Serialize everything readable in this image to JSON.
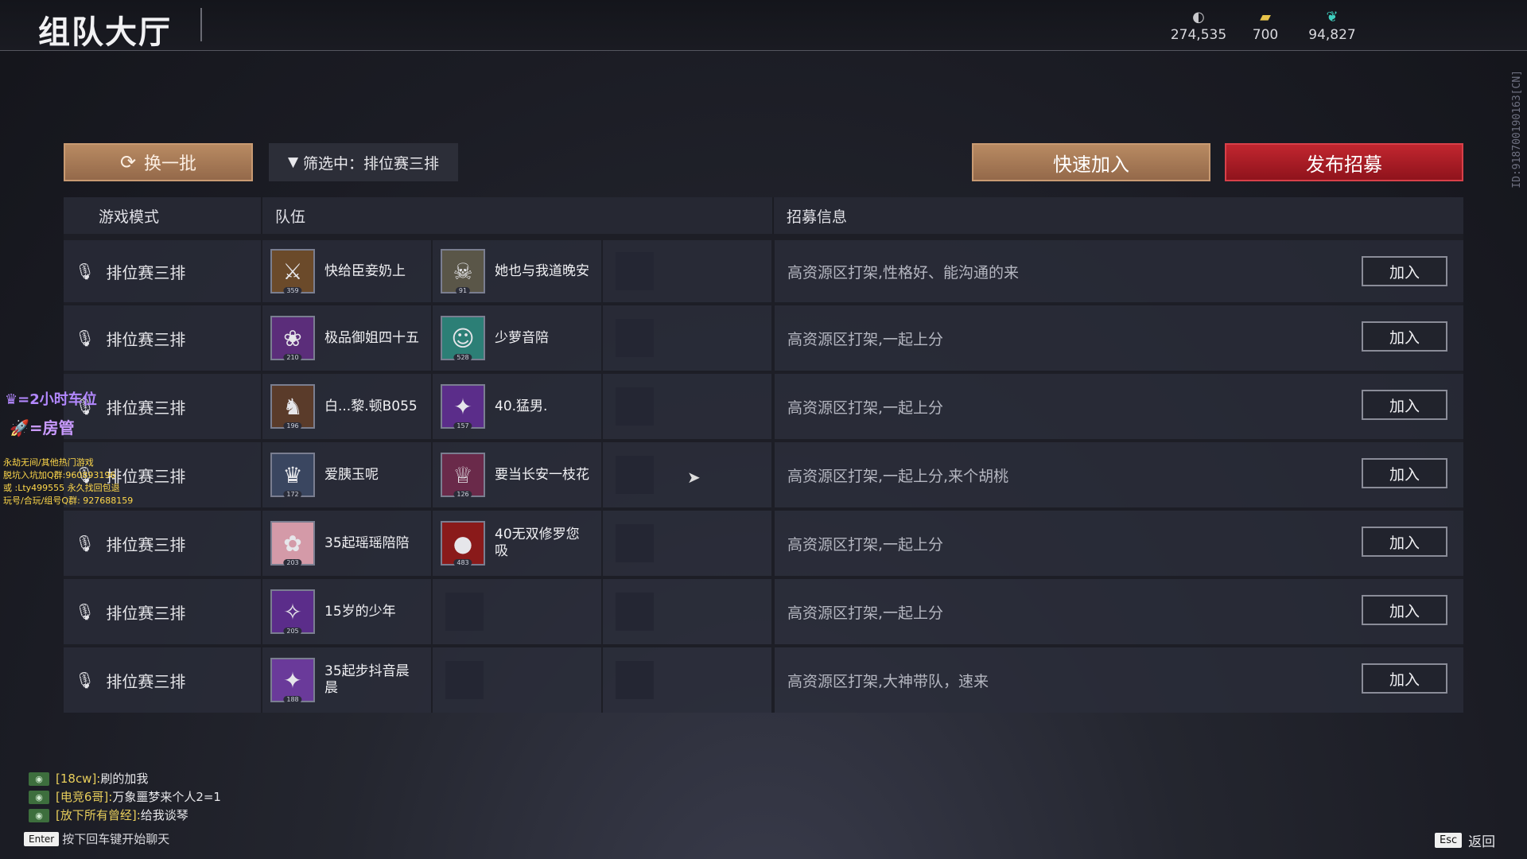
{
  "header": {
    "title": "组队大厅",
    "currencies": [
      {
        "icon": "silver-coin-icon",
        "glyph": "◐",
        "value": "274,535"
      },
      {
        "icon": "gold-ticket-icon",
        "glyph": "▰",
        "value": "700"
      },
      {
        "icon": "feather-icon",
        "glyph": "❦",
        "value": "94,827"
      }
    ],
    "side_id": "ID:9187001901​63[CN]"
  },
  "toolbar": {
    "refresh_label": "换一批",
    "filter_label": "筛选中：排位赛三排",
    "quick_join_label": "快速加入",
    "publish_label": "发布招募"
  },
  "table": {
    "headers": {
      "mode": "游戏模式",
      "team": "队伍",
      "info": "招募信息"
    },
    "join_label": "加入",
    "rows": [
      {
        "mode": "排位赛三排",
        "members": [
          {
            "name": "快给臣妾奶上",
            "level": "359",
            "glyph": "⚔",
            "bg": "#6b4a2a"
          },
          {
            "name": "她也与我道晚安",
            "level": "91",
            "glyph": "☠",
            "bg": "#5a5648"
          }
        ],
        "info": "高资源区打架,性格好、能沟通的来"
      },
      {
        "mode": "排位赛三排",
        "members": [
          {
            "name": "极品御姐四十五",
            "level": "210",
            "glyph": "❀",
            "bg": "#5b2d7a"
          },
          {
            "name": "少萝音陪",
            "level": "528",
            "glyph": "☺",
            "bg": "#2c7f76"
          }
        ],
        "info": "高资源区打架,一起上分"
      },
      {
        "mode": "排位赛三排",
        "members": [
          {
            "name": "白...黎.顿B055",
            "level": "196",
            "glyph": "♞",
            "bg": "#5a3b2a"
          },
          {
            "name": "40.猛男.",
            "level": "157",
            "glyph": "✦",
            "bg": "#5b2d8a"
          }
        ],
        "info": "高资源区打架,一起上分"
      },
      {
        "mode": "排位赛三排",
        "members": [
          {
            "name": "爱胰玉呢",
            "level": "172",
            "glyph": "♛",
            "bg": "#3a4660"
          },
          {
            "name": "要当长安一枝花",
            "level": "126",
            "glyph": "♕",
            "bg": "#6a2a4a"
          }
        ],
        "info": "高资源区打架,一起上分,来个胡桃"
      },
      {
        "mode": "排位赛三排",
        "members": [
          {
            "name": "35起瑶瑶陪陪",
            "level": "203",
            "glyph": "✿",
            "bg": "#d49aa8"
          },
          {
            "name": "40无双修罗您吸",
            "level": "483",
            "glyph": "●",
            "bg": "#8a1a1a"
          }
        ],
        "info": "高资源区打架,一起上分"
      },
      {
        "mode": "排位赛三排",
        "members": [
          {
            "name": "15岁的少年",
            "level": "205",
            "glyph": "✧",
            "bg": "#5b2d8a"
          }
        ],
        "info": "高资源区打架,一起上分"
      },
      {
        "mode": "排位赛三排",
        "members": [
          {
            "name": "35起步抖音晨晨",
            "level": "188",
            "glyph": "✦",
            "bg": "#6a3a9a"
          }
        ],
        "info": "高资源区打架,大神带队，速来"
      }
    ]
  },
  "stream_overlay": {
    "line1": "=2小时车位",
    "line2": "=房管",
    "notes": [
      "永劫无间/其他热门游戏",
      "脱坑入坑加Q群:960893196",
      "或 :Lty499555 永久找回包退",
      "玩号/合玩/组号Q群: 927688159"
    ]
  },
  "chat": {
    "messages": [
      {
        "user": "[18cw]:",
        "text": "刷的加我"
      },
      {
        "user": "[电竞6哥]:",
        "text": "万象噩梦来个人2=1"
      },
      {
        "user": "[放下所有曾经]:",
        "text": "给我谈琴"
      }
    ],
    "enter_key": "Enter",
    "hint": "按下回车键开始聊天",
    "esc_key": "Esc",
    "back_label": "返回"
  },
  "colors": {
    "accent_bronze": "#b88a62",
    "accent_red": "#c1262f",
    "chat_user": "#e9cf5b"
  }
}
